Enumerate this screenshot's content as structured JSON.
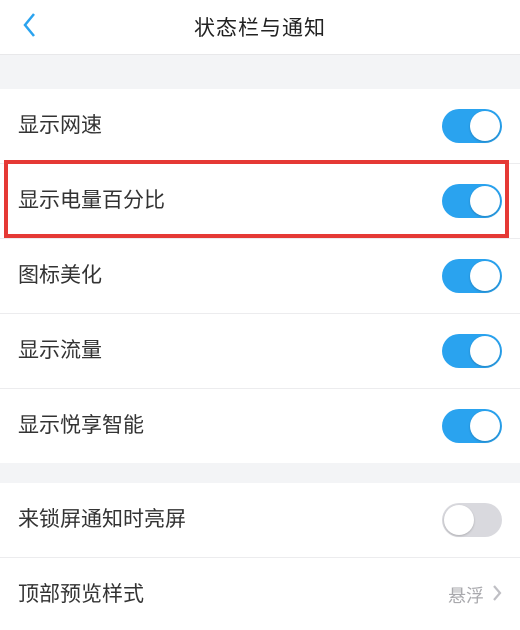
{
  "navbar": {
    "title": "状态栏与通知"
  },
  "rows": {
    "netspeed": {
      "label": "显示网速",
      "on": true
    },
    "battery": {
      "label": "显示电量百分比",
      "on": true
    },
    "iconBeautify": {
      "label": "图标美化",
      "on": true
    },
    "traffic": {
      "label": "显示流量",
      "on": true
    },
    "yuexiang": {
      "label": "显示悦享智能",
      "on": true
    },
    "wakeOnNotify": {
      "label": "来锁屏通知时亮屏",
      "on": false
    },
    "previewStyle": {
      "label": "顶部预览样式",
      "value": "悬浮"
    }
  }
}
